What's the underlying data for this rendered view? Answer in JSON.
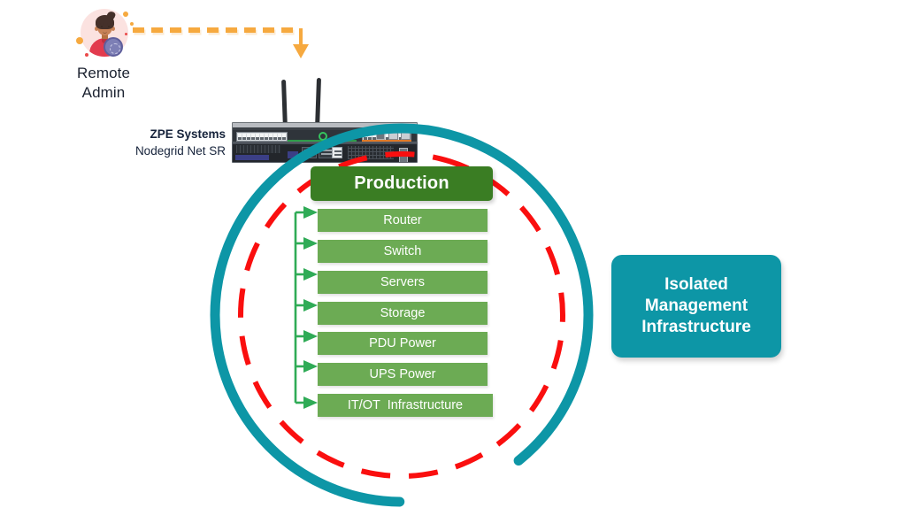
{
  "diagram": {
    "title": "Isolated Management Infrastructure with ZPE Systems Nodegrid Net SR",
    "colors": {
      "teal": "#0d96a6",
      "red_dashed": "#fa0f0f",
      "green_arrow": "#2fab56",
      "green_box": "#6cab54",
      "green_header": "#3a7d23",
      "orange": "#f6a93f"
    }
  },
  "remote_admin": {
    "label": "Remote\nAdmin",
    "label_line1": "Remote",
    "label_line2": "Admin",
    "avatar_icon": "remote-admin-avatar-icon"
  },
  "connection": {
    "icon": "orange-dashed-down-arrow-icon",
    "style": "dashed",
    "color": "#f6a93f"
  },
  "device": {
    "brand": "ZPE Systems",
    "model": "Nodegrid Net SR",
    "image_icon": "rack-appliance-icon"
  },
  "production": {
    "header": "Production",
    "assets": [
      {
        "label": "Router"
      },
      {
        "label": "Switch"
      },
      {
        "label": "Servers"
      },
      {
        "label": "Storage"
      },
      {
        "label": "PDU Power"
      },
      {
        "label": "UPS Power"
      },
      {
        "label": "IT/OT  Infrastructure"
      }
    ]
  },
  "isolated": {
    "line1": "Isolated",
    "line2": "Management",
    "line3": "Infrastructure"
  },
  "perimeters": {
    "outer": {
      "name": "teal-solid-perimeter",
      "color": "#0d96a6"
    },
    "inner": {
      "name": "red-dashed-perimeter",
      "color": "#fa0f0f"
    }
  }
}
